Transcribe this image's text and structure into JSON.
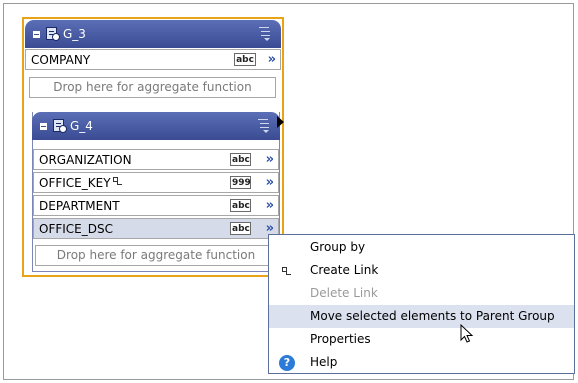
{
  "group_outer": {
    "name": "G_3",
    "fields": [
      {
        "label": "COMPANY",
        "type_badge": "abc"
      }
    ],
    "drop_hint": "Drop here for aggregate function"
  },
  "group_inner": {
    "name": "G_4",
    "fields": [
      {
        "label": "ORGANIZATION",
        "type_badge": "abc"
      },
      {
        "label": "OFFICE_KEY",
        "type_badge": "999"
      },
      {
        "label": "DEPARTMENT",
        "type_badge": "abc"
      },
      {
        "label": "OFFICE_DSC",
        "type_badge": "abc"
      }
    ],
    "drop_hint": "Drop here for aggregate function"
  },
  "context_menu": {
    "items": [
      {
        "label": "Group by",
        "icon": "",
        "enabled": true
      },
      {
        "label": "Create Link",
        "icon": "link-icon",
        "enabled": true
      },
      {
        "label": "Delete Link",
        "icon": "",
        "enabled": false
      },
      {
        "label": "Move selected elements to Parent Group",
        "icon": "",
        "enabled": true,
        "highlighted": true
      },
      {
        "label": "Properties",
        "icon": "",
        "enabled": true
      },
      {
        "label": "Help",
        "icon": "help-icon",
        "enabled": true
      }
    ]
  },
  "colors": {
    "group_header": "#4a5ca6",
    "selection_border": "#e8a317",
    "expand_chevron": "#2b4fa8",
    "menu_highlight": "#dbe1ee",
    "selected_row": "#d6dbe9"
  }
}
